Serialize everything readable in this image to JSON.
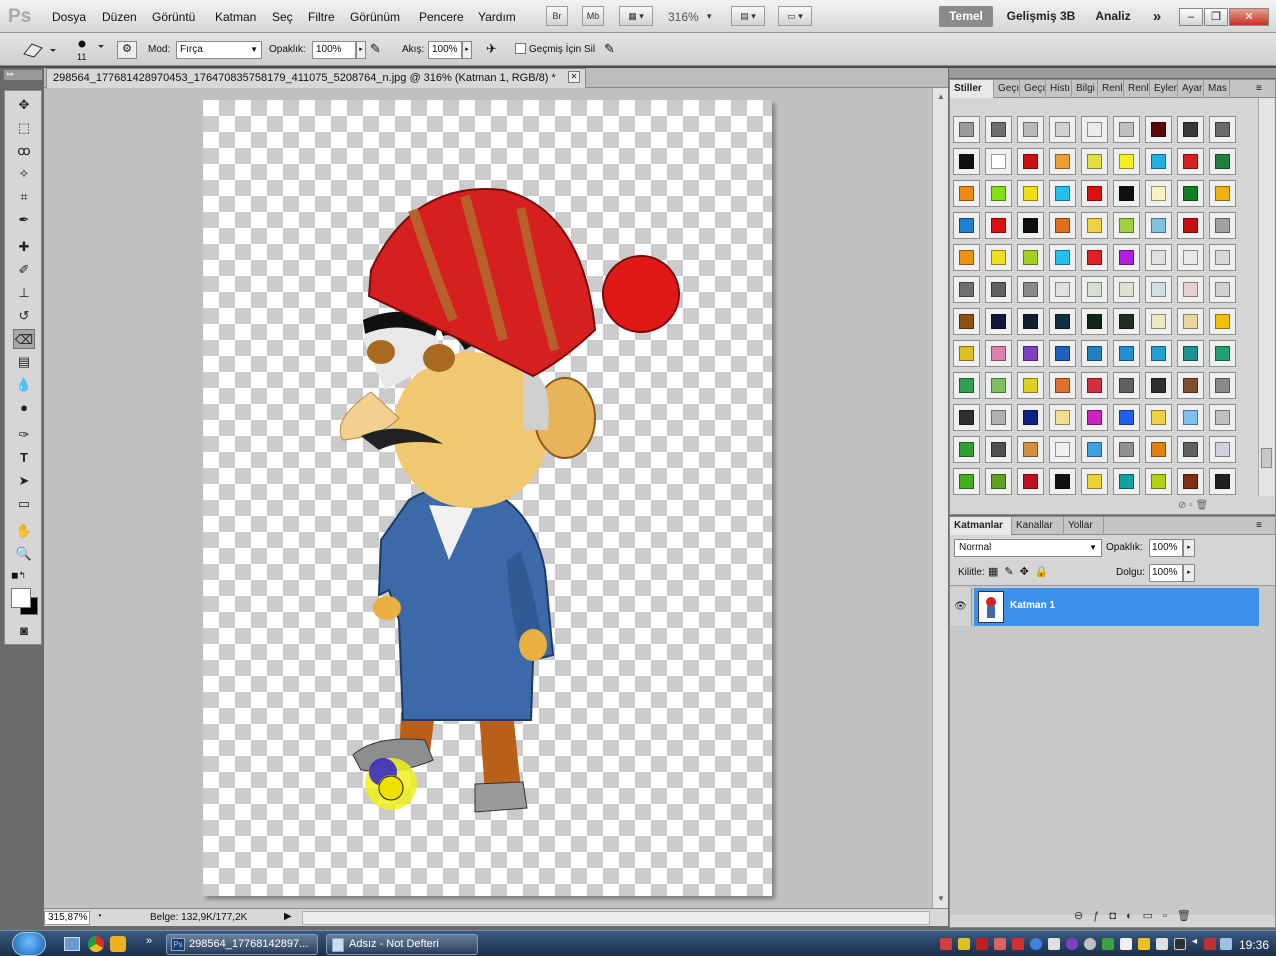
{
  "app": {
    "logo": "Ps"
  },
  "menu": [
    "Dosya",
    "Düzen",
    "Görüntü",
    "Katman",
    "Seç",
    "Filtre",
    "Görünüm",
    "Pencere",
    "Yardım"
  ],
  "appbar": {
    "br": "Br",
    "mb": "Mb",
    "zoom": "316%"
  },
  "workspaces": {
    "active": "Temel",
    "items": [
      "Gelişmiş 3B",
      "Analiz"
    ],
    "more": "»"
  },
  "window_controls": {
    "minimize": "–",
    "restore": "❐",
    "close": "✕"
  },
  "options": {
    "brush_size": "11",
    "mode_label": "Mod:",
    "mode_value": "Fırça",
    "opacity_label": "Opaklık:",
    "opacity_value": "100%",
    "flow_label": "Akış:",
    "flow_value": "100%",
    "history_label": "Geçmiş İçin Sil"
  },
  "document": {
    "tab_title": "298564_177681428970453_176470835758179_411075_5208764_n.jpg @ 316% (Katman 1, RGB/8) *",
    "close": "✕"
  },
  "status": {
    "zoom": "315,87%",
    "doc_info": "Belge: 132,9K/177,2K"
  },
  "styles_panel": {
    "tabs": [
      "Stiller",
      "Geçı",
      "Geçı",
      "Histı",
      "Bilgi",
      "Renl",
      "Renl",
      "Eyler",
      "Ayar",
      "Mas"
    ],
    "colors": [
      "#9a9a9a",
      "#6e6e6e",
      "#b8b8b8",
      "#d0d0d0",
      "#ebebeb",
      "#c0c0c0",
      "#5a0a0a",
      "#3a3a3a",
      "#6a6a6a",
      "#111111",
      "#ffffff",
      "#cc1010",
      "#f0a030",
      "#e0e040",
      "#f8f020",
      "#20b0e8",
      "#d82020",
      "#208040",
      "#f08a10",
      "#80e010",
      "#f0e010",
      "#20c0f0",
      "#e01010",
      "#101010",
      "#fff0c0",
      "#108020",
      "#f0b010",
      "#2080d0",
      "#e01010",
      "#101010",
      "#e07020",
      "#f0d040",
      "#a0d040",
      "#80c0e0",
      "#c01010",
      "#a0a0a0",
      "#f09010",
      "#f0e020",
      "#a0d020",
      "#20c0f0",
      "#e02020",
      "#b020e0",
      "#e0e0e0",
      "#e8e8e8",
      "#d8d8d8",
      "#707070",
      "#606060",
      "#8a8a8a",
      "#e0e0e0",
      "#d8e0d0",
      "#e0e0d0",
      "#d0e0e8",
      "#e8d0d0",
      "#d0d0d0",
      "#905010",
      "#101840",
      "#102030",
      "#103040",
      "#102818",
      "#203020",
      "#f0e8c0",
      "#e8d8a0",
      "#f0c000",
      "#e0c020",
      "#e080b0",
      "#8040c0",
      "#2060c0",
      "#2080c0",
      "#2090d0",
      "#20a0d0",
      "#209090",
      "#20a070",
      "#30a050",
      "#80c060",
      "#e0d020",
      "#e07030",
      "#d03040",
      "#606060",
      "#303030",
      "#805030",
      "#8a8a8a",
      "#303030",
      "#b0b0b0",
      "#102080",
      "#f0e090",
      "#d020c0",
      "#2060f0",
      "#f0d040",
      "#80c0f0",
      "#c0c0c0",
      "#30a030",
      "#505050",
      "#d09040",
      "#f0f0f0",
      "#40a0e0",
      "#909090",
      "#e08010",
      "#606060",
      "#d0d0e0",
      "#40b020",
      "#60a020",
      "#c01020",
      "#111111",
      "#f0d030",
      "#10a0a0",
      "#b0d010",
      "#803010",
      "#202020"
    ]
  },
  "layers_panel": {
    "tabs": [
      "Katmanlar",
      "Kanallar",
      "Yollar"
    ],
    "blend_mode": "Normal",
    "opacity_label": "Opaklık:",
    "opacity_value": "100%",
    "lock_label": "Kilitle:",
    "fill_label": "Dolgu:",
    "fill_value": "100%",
    "layers": [
      {
        "name": "Katman 1",
        "selected": true
      }
    ]
  },
  "taskbar": {
    "tasks": [
      "298564_17768142897...",
      "Adsız - Not Defteri"
    ],
    "clock": "19:36"
  }
}
